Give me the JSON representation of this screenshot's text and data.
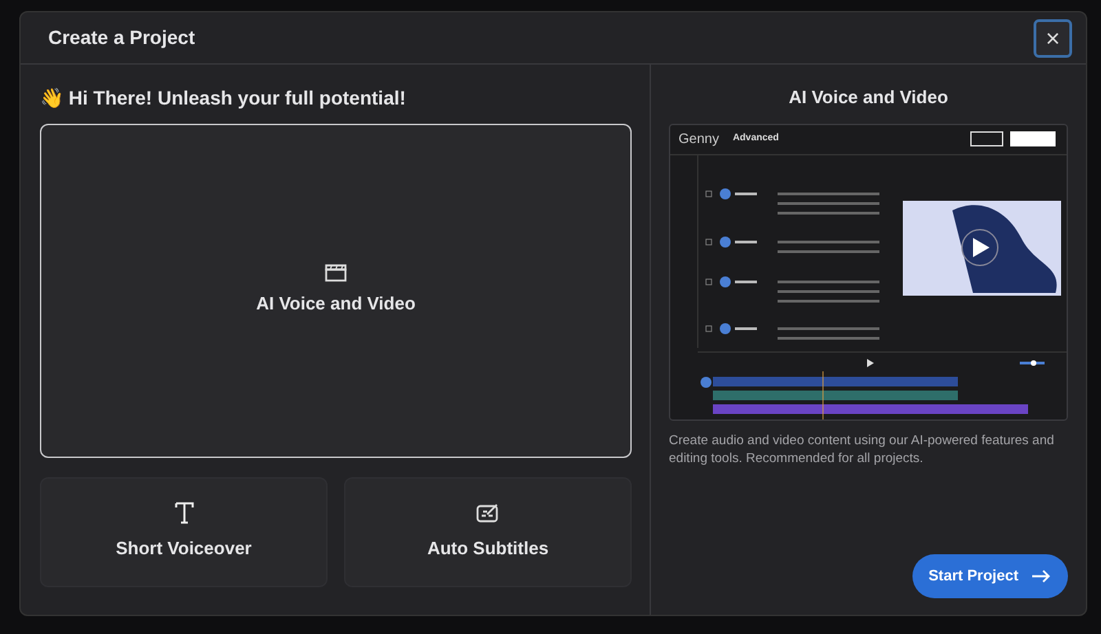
{
  "dialog": {
    "title": "Create a Project",
    "close": "×"
  },
  "greeting": {
    "emoji": "👋",
    "text": "Hi There! Unleash your full potential!"
  },
  "options": [
    {
      "kind": "video",
      "label": "AI Voice and Video",
      "selected": true
    },
    {
      "kind": "voiceover",
      "label": "Short Voiceover",
      "selected": false
    },
    {
      "kind": "subtitles",
      "label": "Auto Subtitles",
      "selected": false
    }
  ],
  "preview": {
    "title": "AI Voice and Video",
    "logo": "Genny",
    "mode": "Advanced",
    "description": "Create audio and video content using our AI-powered features and editing tools. Recommended for all projects."
  },
  "start_button": {
    "label": "Start Project"
  }
}
